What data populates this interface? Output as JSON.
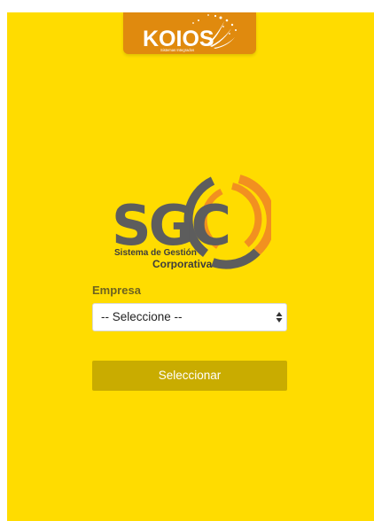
{
  "brand": {
    "koios_wordmark": "KOIOS",
    "koios_tagline": "Sistemas Integrados",
    "sgc_letters": "SGC",
    "sgc_line1": "Sistema de Gestión",
    "sgc_line2": "Corporativa"
  },
  "form": {
    "company_label": "Empresa",
    "company_select_value": "-- Seleccione --",
    "submit_label": "Seleccionar"
  },
  "colors": {
    "background": "#FFDC00",
    "banner": "#E08A0E",
    "button": "#C9AC00",
    "logo_gray": "#5D5D5D",
    "logo_orange": "#F29020"
  },
  "icons": {
    "select_arrow": "select-updown-arrows-icon"
  }
}
